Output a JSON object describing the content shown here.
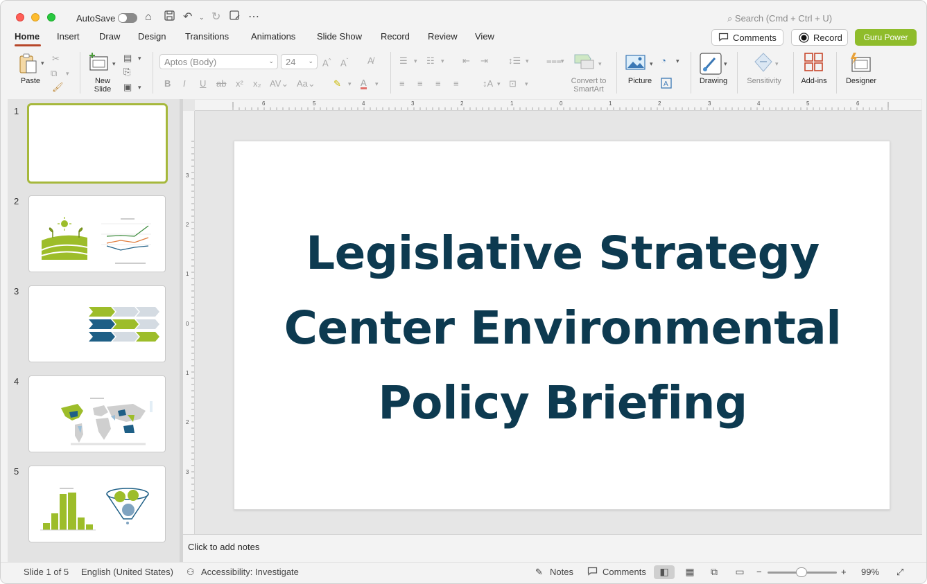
{
  "titlebar": {
    "autosave_label": "AutoSave",
    "search_placeholder": "Search (Cmd + Ctrl + U)"
  },
  "tabs": [
    {
      "label": "Home",
      "active": true
    },
    {
      "label": "Insert"
    },
    {
      "label": "Draw"
    },
    {
      "label": "Design"
    },
    {
      "label": "Transitions"
    },
    {
      "label": "Animations"
    },
    {
      "label": "Slide Show"
    },
    {
      "label": "Record"
    },
    {
      "label": "Review"
    },
    {
      "label": "View"
    }
  ],
  "header_buttons": {
    "comments": "Comments",
    "record": "Record",
    "guru": "Guru Power"
  },
  "ribbon": {
    "paste": "Paste",
    "new_slide_line1": "New",
    "new_slide_line2": "Slide",
    "font_name": "Aptos (Body)",
    "font_size": "24",
    "convert_line1": "Convert to",
    "convert_line2": "SmartArt",
    "picture": "Picture",
    "drawing": "Drawing",
    "sensitivity": "Sensitivity",
    "addins": "Add-ins",
    "designer": "Designer"
  },
  "thumbnails": [
    {
      "number": "1"
    },
    {
      "number": "2"
    },
    {
      "number": "3"
    },
    {
      "number": "4"
    },
    {
      "number": "5"
    }
  ],
  "slide": {
    "title_line1": "Legislative Strategy",
    "title_line2": "Center Environmental",
    "title_line3": "Policy Briefing"
  },
  "ruler": {
    "h_labels": [
      "6",
      "5",
      "4",
      "3",
      "2",
      "1",
      "0",
      "1",
      "2",
      "3",
      "4",
      "5",
      "6"
    ],
    "v_labels": [
      "3",
      "2",
      "1",
      "0",
      "1",
      "2",
      "3"
    ]
  },
  "notes": {
    "placeholder": "Click to add notes"
  },
  "status": {
    "slide_info": "Slide 1 of 5",
    "language": "English (United States)",
    "accessibility": "Accessibility: Investigate",
    "notes": "Notes",
    "comments": "Comments",
    "zoom": "99%"
  },
  "colors": {
    "accent_green": "#8fbc2b",
    "title_navy": "#0d3a50",
    "tab_underline": "#b7472a"
  }
}
